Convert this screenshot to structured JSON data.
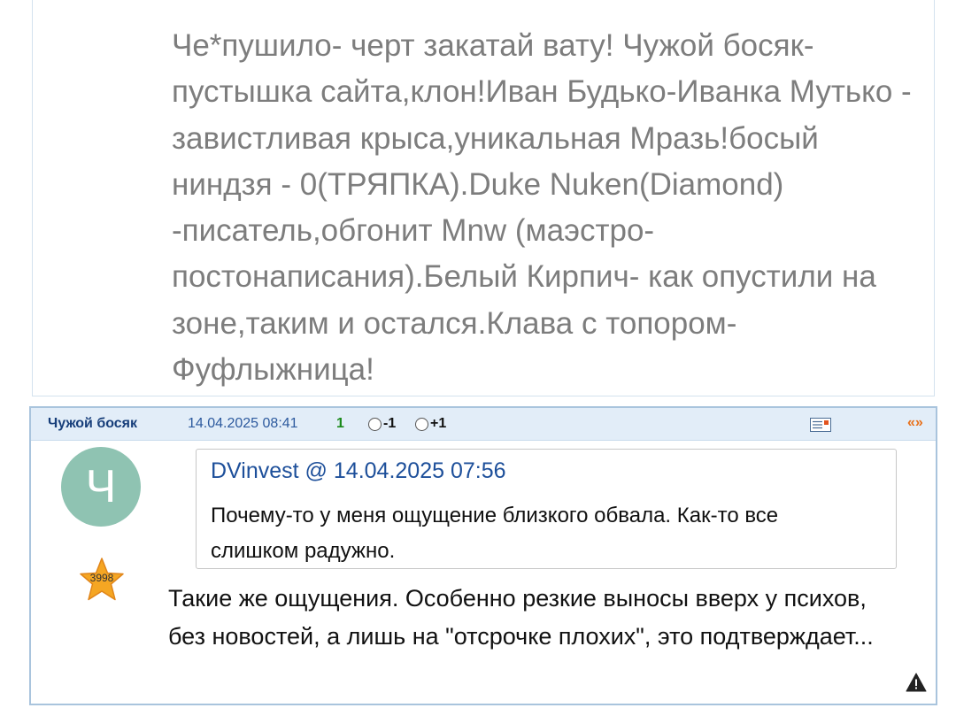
{
  "previous_post": {
    "text": "Че*пушило- черт закатай вату! Чужой босяк- пустышка сайта,клон!Иван Будько-Иванка Мутько - завистливая крыса,уникальная Мразь!босый ниндзя - 0(ТРЯПКА).Duke Nuken(Diamond) -писатель,обгонит Mnw (маэстро-постонаписания).Белый Кирпич- как опустили на зоне,таким и остался.Клава с топором- Фуфлыжница!"
  },
  "comment": {
    "author": "Чужой босяк",
    "datetime": "14.04.2025 08:41",
    "rating": "1",
    "vote_minus_label": "-1",
    "vote_plus_label": "+1",
    "quote_link_label": "«»",
    "avatar_letter": "Ч",
    "star_count": "3998",
    "quote": {
      "author": "DVinvest",
      "at": "@",
      "datetime": "14.04.2025 07:56",
      "text": "Почему-то у меня ощущение близкого обвала. Как-то все слишком радужно."
    },
    "text": "Такие же ощущения. Особенно резкие выносы вверх у психов, без новостей, а лишь на \"отсрочке плохих\", это подтверждает..."
  },
  "icons": {
    "message": "message-icon",
    "report": "warning-icon",
    "star": "star-icon"
  },
  "colors": {
    "header_bg": "#e2edf8",
    "author": "#173e7a",
    "rating_positive": "#1b8a1b",
    "quote_link": "#e8701a",
    "avatar_bg": "#8fc3b2",
    "star": "#f5a623"
  }
}
